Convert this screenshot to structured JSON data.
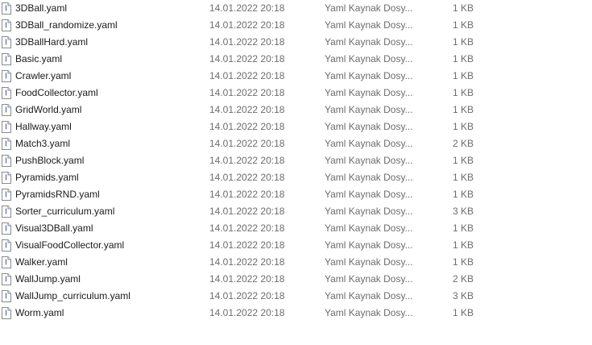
{
  "icons": {
    "file": "text-file-icon"
  },
  "files": [
    {
      "name": "3DBall.yaml",
      "modified": "14.01.2022 20:18",
      "type": "Yaml Kaynak Dosy...",
      "size": "1 KB"
    },
    {
      "name": "3DBall_randomize.yaml",
      "modified": "14.01.2022 20:18",
      "type": "Yaml Kaynak Dosy...",
      "size": "1 KB"
    },
    {
      "name": "3DBallHard.yaml",
      "modified": "14.01.2022 20:18",
      "type": "Yaml Kaynak Dosy...",
      "size": "1 KB"
    },
    {
      "name": "Basic.yaml",
      "modified": "14.01.2022 20:18",
      "type": "Yaml Kaynak Dosy...",
      "size": "1 KB"
    },
    {
      "name": "Crawler.yaml",
      "modified": "14.01.2022 20:18",
      "type": "Yaml Kaynak Dosy...",
      "size": "1 KB"
    },
    {
      "name": "FoodCollector.yaml",
      "modified": "14.01.2022 20:18",
      "type": "Yaml Kaynak Dosy...",
      "size": "1 KB"
    },
    {
      "name": "GridWorld.yaml",
      "modified": "14.01.2022 20:18",
      "type": "Yaml Kaynak Dosy...",
      "size": "1 KB"
    },
    {
      "name": "Hallway.yaml",
      "modified": "14.01.2022 20:18",
      "type": "Yaml Kaynak Dosy...",
      "size": "1 KB"
    },
    {
      "name": "Match3.yaml",
      "modified": "14.01.2022 20:18",
      "type": "Yaml Kaynak Dosy...",
      "size": "2 KB"
    },
    {
      "name": "PushBlock.yaml",
      "modified": "14.01.2022 20:18",
      "type": "Yaml Kaynak Dosy...",
      "size": "1 KB"
    },
    {
      "name": "Pyramids.yaml",
      "modified": "14.01.2022 20:18",
      "type": "Yaml Kaynak Dosy...",
      "size": "1 KB"
    },
    {
      "name": "PyramidsRND.yaml",
      "modified": "14.01.2022 20:18",
      "type": "Yaml Kaynak Dosy...",
      "size": "1 KB"
    },
    {
      "name": "Sorter_curriculum.yaml",
      "modified": "14.01.2022 20:18",
      "type": "Yaml Kaynak Dosy...",
      "size": "3 KB"
    },
    {
      "name": "Visual3DBall.yaml",
      "modified": "14.01.2022 20:18",
      "type": "Yaml Kaynak Dosy...",
      "size": "1 KB"
    },
    {
      "name": "VisualFoodCollector.yaml",
      "modified": "14.01.2022 20:18",
      "type": "Yaml Kaynak Dosy...",
      "size": "1 KB"
    },
    {
      "name": "Walker.yaml",
      "modified": "14.01.2022 20:18",
      "type": "Yaml Kaynak Dosy...",
      "size": "1 KB"
    },
    {
      "name": "WallJump.yaml",
      "modified": "14.01.2022 20:18",
      "type": "Yaml Kaynak Dosy...",
      "size": "2 KB"
    },
    {
      "name": "WallJump_curriculum.yaml",
      "modified": "14.01.2022 20:18",
      "type": "Yaml Kaynak Dosy...",
      "size": "3 KB"
    },
    {
      "name": "Worm.yaml",
      "modified": "14.01.2022 20:18",
      "type": "Yaml Kaynak Dosy...",
      "size": "1 KB"
    }
  ]
}
